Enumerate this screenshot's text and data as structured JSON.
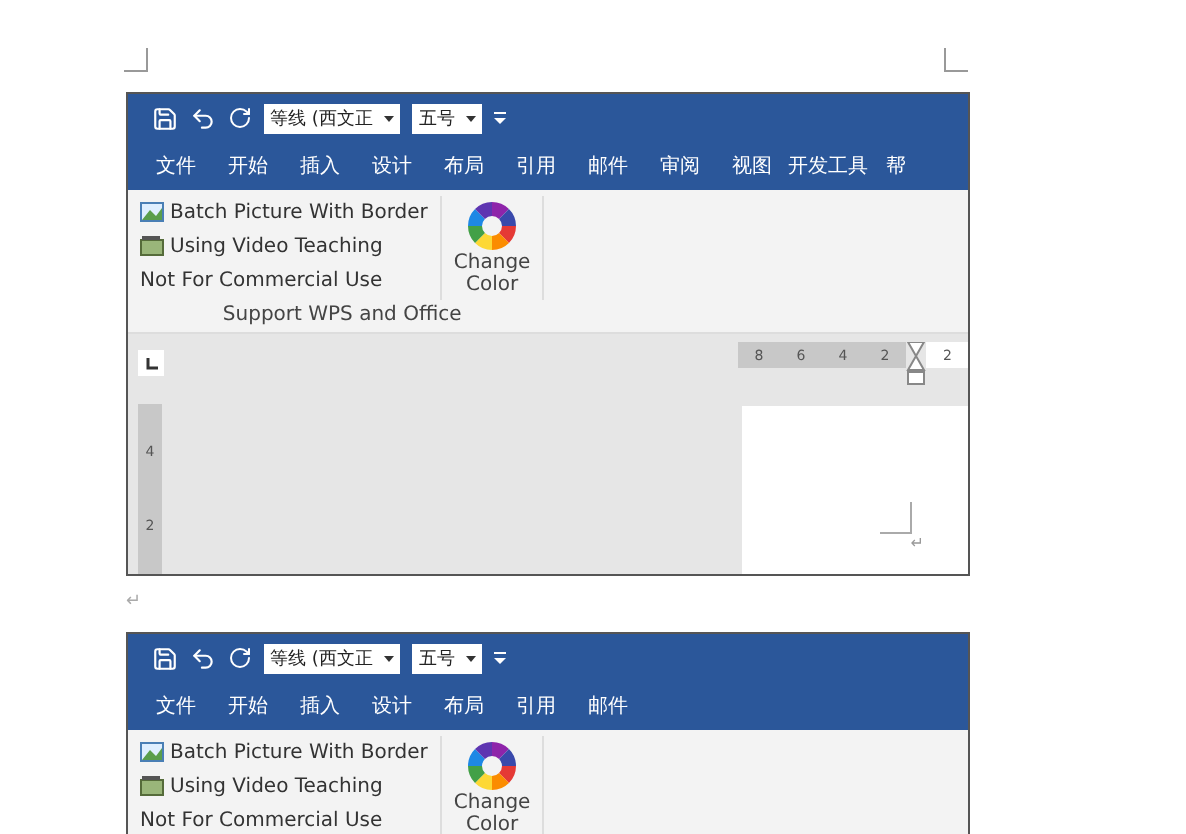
{
  "shots": [
    {
      "font_box": "等线 (西文正",
      "size_box": "五号",
      "tabs": [
        "文件",
        "开始",
        "插入",
        "设计",
        "布局",
        "引用",
        "邮件",
        "审阅",
        "视图",
        "开发工具",
        "帮"
      ],
      "ribbon": {
        "items": [
          {
            "kind": "picture",
            "label": "Batch Picture With Border"
          },
          {
            "kind": "video",
            "label": "Using Video Teaching"
          },
          {
            "kind": "plain",
            "label": "Not For Commercial Use"
          }
        ],
        "button": [
          "Change",
          "Color"
        ],
        "group_label": "Support  WPS and Office"
      },
      "workspace": {
        "h_ruler": [
          "8",
          "6",
          "4",
          "2",
          "2"
        ],
        "v_ruler": [
          "4",
          "2"
        ],
        "return_mark": "↵"
      }
    },
    {
      "font_box": "等线 (西文正",
      "size_box": "五号",
      "tabs": [
        "文件",
        "开始",
        "插入",
        "设计",
        "布局",
        "引用",
        "邮件"
      ],
      "ribbon": {
        "items": [
          {
            "kind": "picture",
            "label": "Batch Picture With Border"
          },
          {
            "kind": "video",
            "label": "Using Video Teaching"
          },
          {
            "kind": "plain",
            "label": "Not For Commercial Use"
          }
        ],
        "button": [
          "Change",
          "Color"
        ]
      }
    }
  ],
  "paragraph_mark": "↵"
}
